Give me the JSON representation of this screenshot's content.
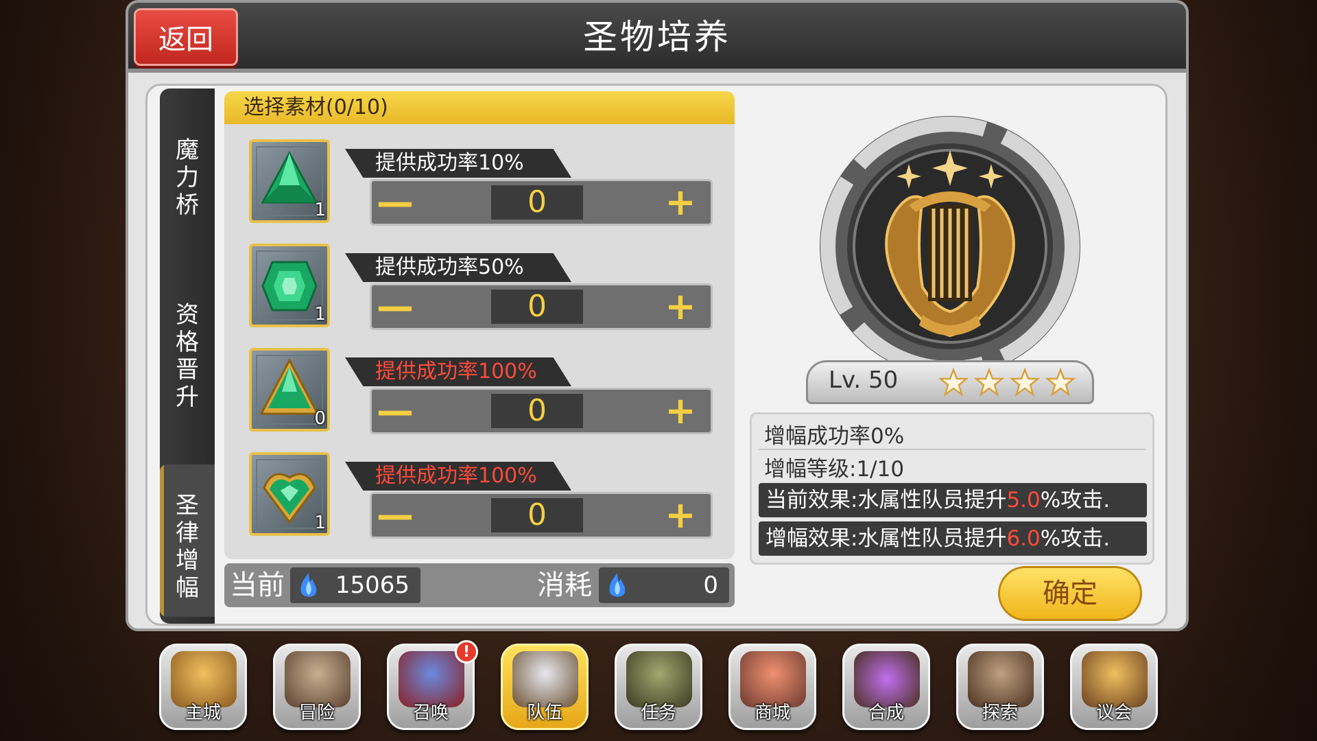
{
  "title": "圣物培养",
  "back_label": "返回",
  "tabs": [
    {
      "label": "魔\n力\n桥"
    },
    {
      "label": "资\n格\n晋\n升"
    },
    {
      "label": "圣\n律\n增\n幅"
    }
  ],
  "material": {
    "header": "选择素材(0/10)",
    "rows": [
      {
        "rate": "提供成功率10%",
        "count": "1",
        "value": "0",
        "highlight": false
      },
      {
        "rate": "提供成功率50%",
        "count": "1",
        "value": "0",
        "highlight": false
      },
      {
        "rate": "提供成功率100%",
        "count": "0",
        "value": "0",
        "highlight": true
      },
      {
        "rate": "提供成功率100%",
        "count": "1",
        "value": "0",
        "highlight": true
      }
    ],
    "minus": "—",
    "plus": "+"
  },
  "currency": {
    "current_label": "当前",
    "current_value": "15065",
    "cost_label": "消耗",
    "cost_value": "0"
  },
  "relic": {
    "level": "Lv. 50",
    "stars": 4
  },
  "info": {
    "success_rate": "增幅成功率0%",
    "level": "增幅等级:1/10",
    "current_prefix": "当前效果:水属性队员提升",
    "current_value": "5.0",
    "current_suffix": "%攻击.",
    "next_prefix": "增幅效果:水属性队员提升",
    "next_value": "6.0",
    "next_suffix": "%攻击."
  },
  "confirm_label": "确定",
  "nav": [
    {
      "label": "主城",
      "color": "#c89040"
    },
    {
      "label": "冒险",
      "color": "#8a6a50"
    },
    {
      "label": "召唤",
      "color": "#3a5ab0",
      "badge": "!"
    },
    {
      "label": "队伍",
      "color": "#d0a030",
      "active": true
    },
    {
      "label": "任务",
      "color": "#5a6a3a"
    },
    {
      "label": "商城",
      "color": "#c06a50"
    },
    {
      "label": "合成",
      "color": "#8a5ab0"
    },
    {
      "label": "探索",
      "color": "#8a6a4a"
    },
    {
      "label": "议会",
      "color": "#c09040"
    }
  ],
  "colors": {
    "gem": "#1fb86a",
    "accent_yellow": "#f4cf42",
    "highlight_red": "#ff4a3a"
  }
}
